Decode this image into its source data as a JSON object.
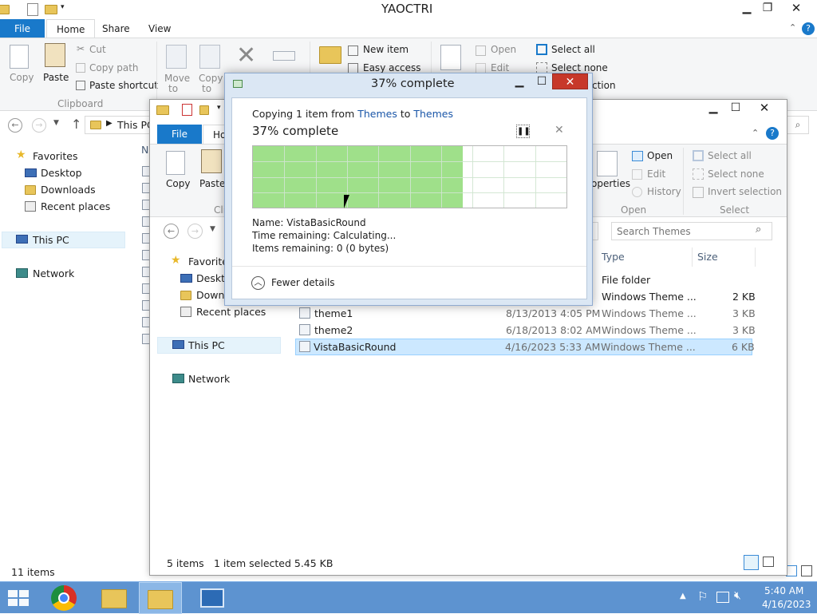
{
  "back_window": {
    "title": "YAOCTRI",
    "tabs": [
      "File",
      "Home",
      "Share",
      "View"
    ],
    "clipboard": {
      "copy": "Copy",
      "paste": "Paste",
      "cut": "Cut",
      "copy_path": "Copy path",
      "paste_shortcut": "Paste shortcut",
      "group": "Clipboard"
    },
    "organize": {
      "move_to_1": "Move",
      "move_to_2": "to",
      "copy_to_1": "Copy",
      "copy_to_2": "to"
    },
    "new": {
      "new_item": "New item",
      "easy_access": "Easy access"
    },
    "open": {
      "open": "Open",
      "edit": "Edit"
    },
    "select": {
      "select_all": "Select all",
      "select_none": "Select none",
      "invert_partial": "ction"
    },
    "address": "This PC",
    "nav": {
      "favorites": "Favorites",
      "desktop": "Desktop",
      "downloads": "Downloads",
      "recent": "Recent places",
      "this_pc": "This PC",
      "network": "Network"
    },
    "col_partial": "N",
    "status": "11 items"
  },
  "front_window": {
    "tabs": [
      "File",
      "Ho"
    ],
    "clipboard": {
      "copy": "Copy",
      "paste": "Paste",
      "group_partial": "Cli"
    },
    "open": {
      "properties_partial": "operties",
      "open": "Open",
      "edit": "Edit",
      "history": "History",
      "group": "Open"
    },
    "select": {
      "select_all": "Select all",
      "select_none": "Select none",
      "invert": "Invert selection",
      "group": "Select"
    },
    "search_placeholder": "Search Themes",
    "nav": {
      "favorites": "Favorites",
      "desktop": "Deskto",
      "downloads": "Downl",
      "recent": "Recent places",
      "this_pc": "This PC",
      "network": "Network"
    },
    "columns": {
      "type": "Type",
      "size": "Size"
    },
    "rows": [
      {
        "name": "",
        "date": "",
        "type": "File folder",
        "size": ""
      },
      {
        "name": "",
        "date": "",
        "type": "Windows Theme ...",
        "size": "2 KB"
      },
      {
        "name": "theme1",
        "date": "8/13/2013 4:05 PM",
        "type": "Windows Theme ...",
        "size": "3 KB"
      },
      {
        "name": "theme2",
        "date": "6/18/2013 8:02 AM",
        "type": "Windows Theme ...",
        "size": "3 KB"
      },
      {
        "name": "VistaBasicRound",
        "date": "4/16/2023 5:33 AM",
        "type": "Windows Theme ...",
        "size": "6 KB"
      }
    ],
    "status_items": "5 items",
    "status_selected": "1 item selected  5.45 KB"
  },
  "dialog": {
    "title": "37% complete",
    "copying_prefix": "Copying 1 item from ",
    "from": "Themes",
    "to_word": " to ",
    "to": "Themes",
    "heading": "37% complete",
    "progress": 0.67,
    "name": "Name:  VistaBasicRound",
    "time": "Time remaining:  Calculating...",
    "items": "Items remaining:  0 (0 bytes)",
    "fewer": "Fewer details",
    "accent": "#9fe08a"
  },
  "taskbar": {
    "time": "5:40 AM",
    "date": "4/16/2023"
  }
}
